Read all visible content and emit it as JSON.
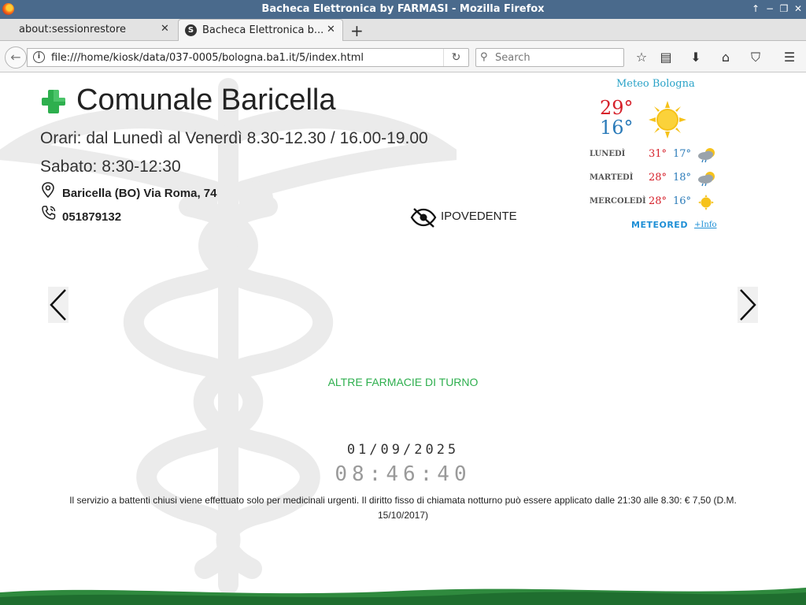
{
  "window": {
    "title": "Bacheca Elettronica by FARMASI - Mozilla Firefox",
    "controls": [
      "↑",
      "−",
      "❐",
      "✕"
    ]
  },
  "tabs": [
    {
      "label": "about:sessionrestore",
      "close": "✕"
    },
    {
      "label": "Bacheca Elettronica b...",
      "favicon": "S",
      "close": "✕",
      "active": true
    }
  ],
  "newtab": "+",
  "navbar": {
    "back": "←",
    "url": "file:///home/kiosk/data/037-0005/bologna.ba1.it/5/index.html",
    "reload": "↻",
    "search_placeholder": "Search",
    "icons": [
      "star-icon",
      "reading-list-icon",
      "download-icon",
      "home-icon",
      "pocket-icon",
      "menu-icon"
    ]
  },
  "pharmacy": {
    "name": "Comunale Baricella",
    "hours_weekdays": "Orari: dal Lunedì al Venerdì 8.30-12.30 / 16.00-19.00",
    "hours_saturday": "Sabato: 8:30-12:30",
    "address": "Baricella (BO) Via Roma, 74",
    "phone": "051879132",
    "accessibility_label": "IPOVEDENTE",
    "accent_color": "#2eaf4e"
  },
  "weather": {
    "title": "Meteo Bologna",
    "today_max": "29°",
    "today_min": "16°",
    "today_icon": "sun-icon",
    "forecast": [
      {
        "day": "LUNEDÌ",
        "max": "31°",
        "min": "17°",
        "icon": "cloud-rain-sun-icon"
      },
      {
        "day": "MARTEDÌ",
        "max": "28°",
        "min": "18°",
        "icon": "cloud-rain-sun-icon"
      },
      {
        "day": "MERCOLEDÌ",
        "max": "28°",
        "min": "16°",
        "icon": "sun-icon"
      }
    ],
    "provider": "METEORED",
    "more_link": "+Info"
  },
  "main": {
    "other_pharmacies": "ALTRE FARMACIE DI TURNO",
    "date": "01/09/2025",
    "time": "08:46:40",
    "notice": "Il servizio a battenti chiusi viene effettuato solo per medicinali urgenti. Il diritto fisso di chiamata notturno può essere applicato dalle 21:30 alle 8.30: € 7,50 (D.M. 15/10/2017)"
  }
}
